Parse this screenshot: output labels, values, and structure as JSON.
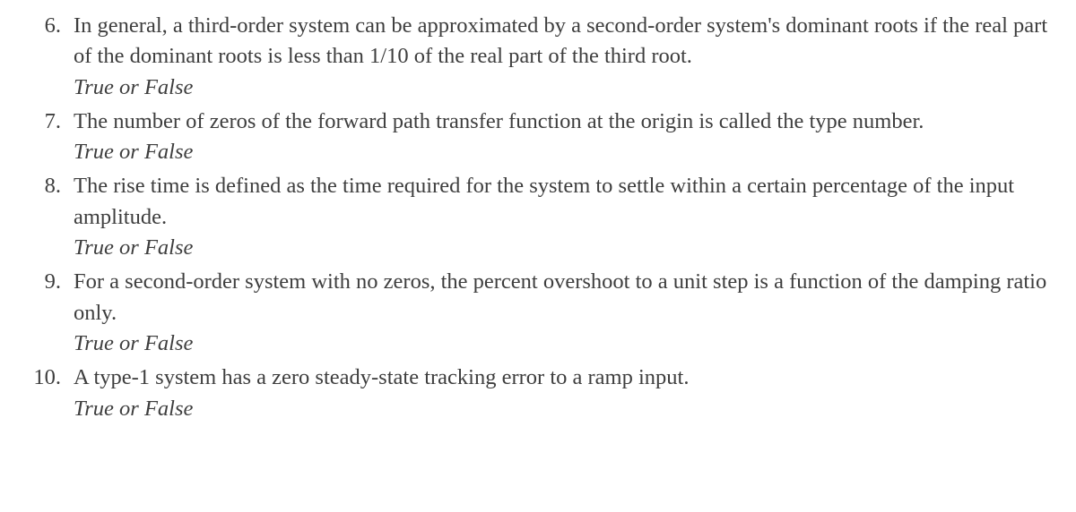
{
  "questions": [
    {
      "number": "6.",
      "text": "In general, a third-order system can be approximated by a second-order system's dominant roots if the real part of the dominant roots is less than 1/10 of the real part of the third root.",
      "prompt": "True or False"
    },
    {
      "number": "7.",
      "text": "The number of zeros of the forward path transfer function at the origin is called the type number.",
      "prompt": "True or False"
    },
    {
      "number": "8.",
      "text": "The rise time is defined as the time required for the system to settle within a certain percentage of the input amplitude.",
      "prompt": "True or False"
    },
    {
      "number": "9.",
      "text": "For a second-order system with no zeros, the percent overshoot to a unit step is a function of the damping ratio only.",
      "prompt": "True or False"
    },
    {
      "number": "10.",
      "text": "A type-1 system has a zero steady-state tracking error to a ramp input.",
      "prompt": "True or False"
    }
  ]
}
